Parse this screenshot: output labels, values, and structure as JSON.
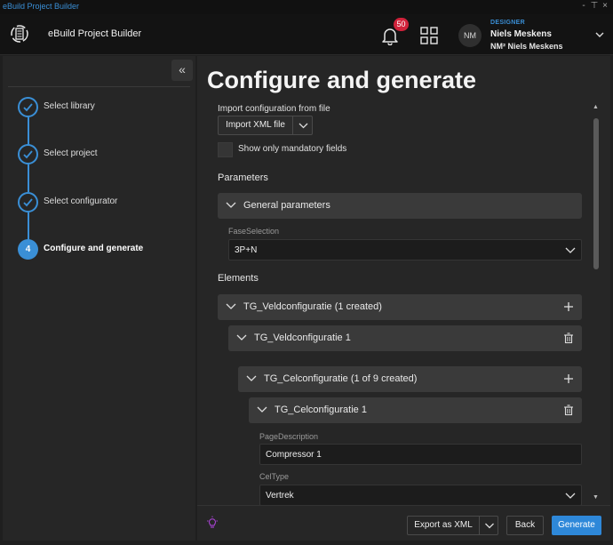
{
  "window": {
    "title": "eBuild Project Builder",
    "controls": [
      "-",
      "⊤",
      "×"
    ]
  },
  "header": {
    "app_name": "eBuild Project Builder",
    "notifications_count": "50",
    "user_initials": "NM",
    "user_role": "DESIGNER",
    "user_name": "Niels Meskens",
    "user_org": "NM² Niels Meskens"
  },
  "sidebar": {
    "collapse_label": "«",
    "steps": [
      {
        "label": "Select library",
        "state": "done"
      },
      {
        "label": "Select project",
        "state": "done"
      },
      {
        "label": "Select configurator",
        "state": "done"
      },
      {
        "number": "4",
        "label": "Configure and generate",
        "state": "active"
      }
    ]
  },
  "main": {
    "title": "Configure and generate",
    "import_label": "Import configuration from file",
    "import_button": "Import XML file",
    "mandatory_label": "Show only mandatory fields",
    "parameters_heading": "Parameters",
    "general_parameters": "General parameters",
    "fase_label": "FaseSelection",
    "fase_value": "3P+N",
    "elements_heading": "Elements",
    "veld_group": "TG_Veldconfiguratie (1 created)",
    "veld_item": "TG_Veldconfiguratie 1",
    "cel_group": "TG_Celconfiguratie (1 of 9 created)",
    "cel_item": "TG_Celconfiguratie 1",
    "pagedesc_label": "PageDescription",
    "pagedesc_value": "Compressor 1",
    "celtype_label": "CelType",
    "celtype_value": "Vertrek"
  },
  "footer": {
    "export_button": "Export as XML",
    "back_button": "Back",
    "generate_button": "Generate"
  },
  "colors": {
    "accent": "#2e88d9",
    "badge": "#d0223b",
    "role": "#3a8fd6"
  }
}
